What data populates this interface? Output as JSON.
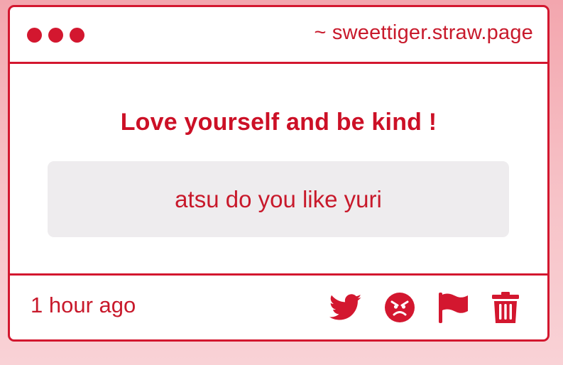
{
  "window": {
    "url": "~ sweettiger.straw.page"
  },
  "post": {
    "heading": "Love yourself and be kind !",
    "question": "atsu do you like yuri",
    "timestamp": "1 hour ago"
  },
  "actions": {
    "icons": [
      "twitter-icon",
      "angry-face-icon",
      "flag-icon",
      "trash-icon"
    ]
  },
  "colors": {
    "accent": "#d3172f",
    "question_bg": "#eeecee",
    "page_bg_top": "#f3a6ae",
    "page_bg_bottom": "#f9d2d6"
  }
}
